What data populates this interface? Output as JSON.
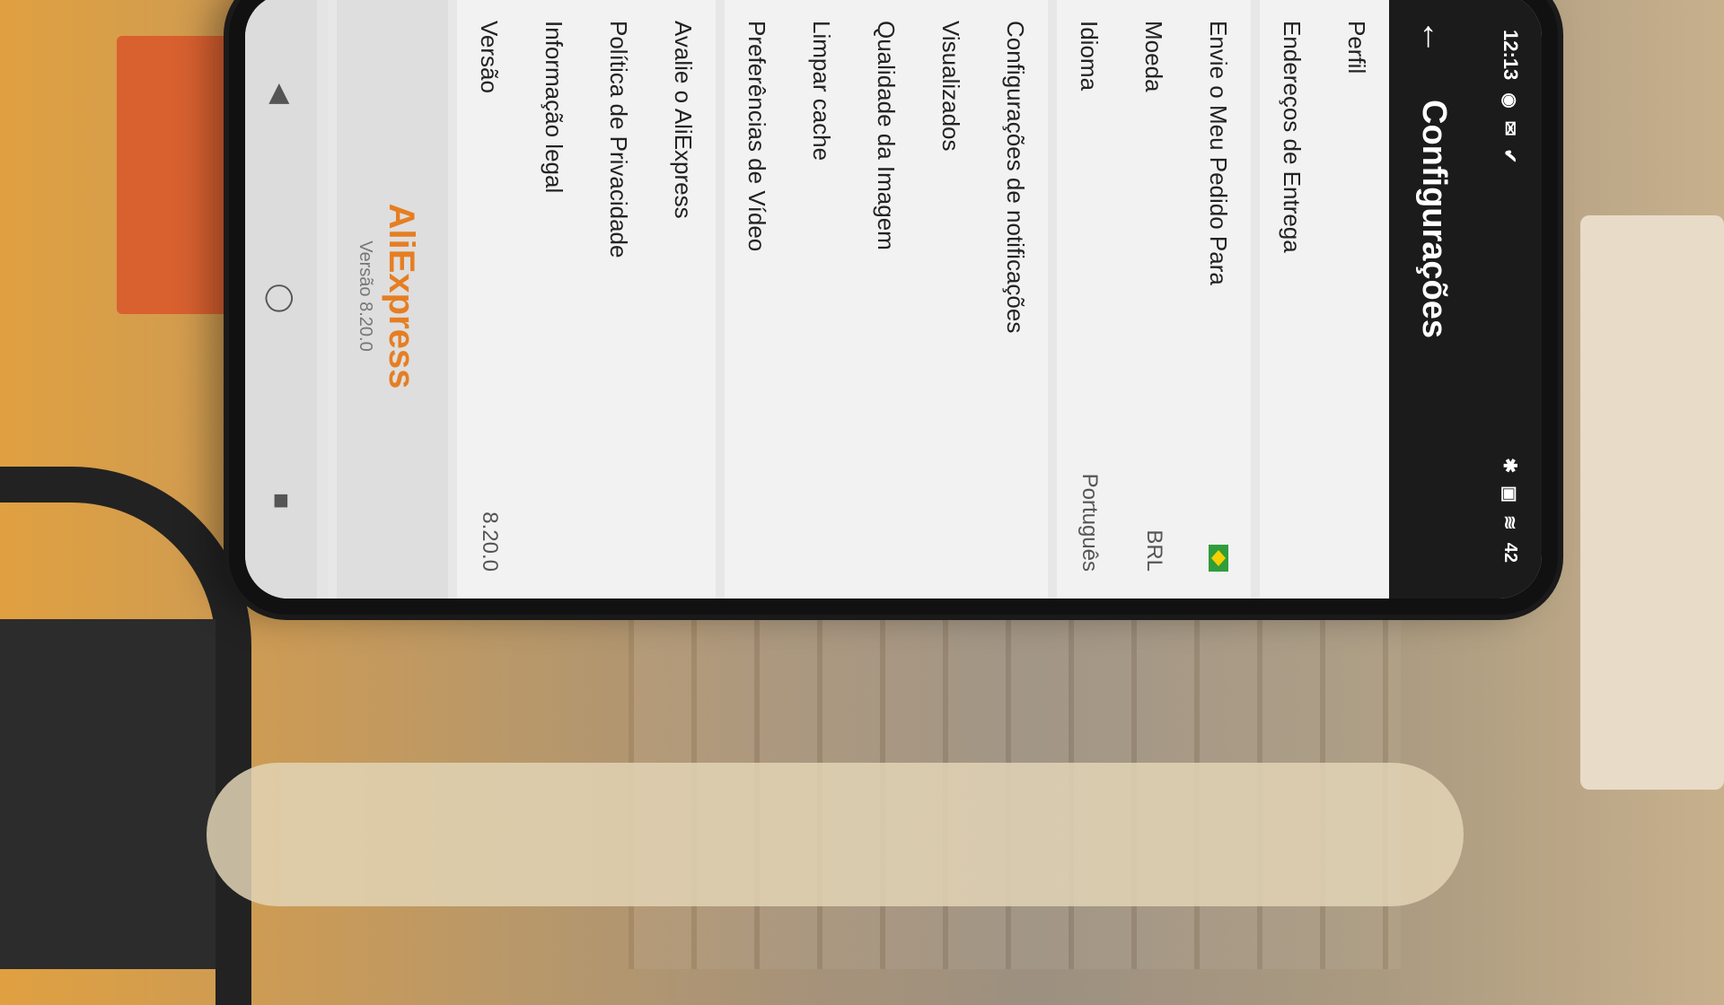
{
  "status_bar": {
    "time": "12:13",
    "battery": "42"
  },
  "app_bar": {
    "title": "Configurações"
  },
  "settings": {
    "group1": [
      {
        "label": "Perfil"
      },
      {
        "label": "Endereços de Entrega"
      }
    ],
    "group2": [
      {
        "label": "Envie o Meu Pedido Para",
        "flag": "brazil-flag-icon"
      },
      {
        "label": "Moeda",
        "value": "BRL"
      },
      {
        "label": "Idioma",
        "value": "Português"
      }
    ],
    "group3": [
      {
        "label": "Configurações de notificações"
      },
      {
        "label": "Visualizados"
      },
      {
        "label": "Qualidade da Imagem"
      },
      {
        "label": "Limpar cache"
      },
      {
        "label": "Preferências de Vídeo"
      }
    ],
    "group4": [
      {
        "label": "Avalie o AliExpress"
      },
      {
        "label": "Política de Privacidade"
      },
      {
        "label": "Informação legal"
      },
      {
        "label": "Versão",
        "value": "8.20.0"
      }
    ]
  },
  "footer": {
    "logo_a": "Ali",
    "logo_b": "Express",
    "version": "Versão 8.20.0"
  },
  "colors": {
    "accent": "#c0392b",
    "appbar": "#1b1b1b"
  }
}
